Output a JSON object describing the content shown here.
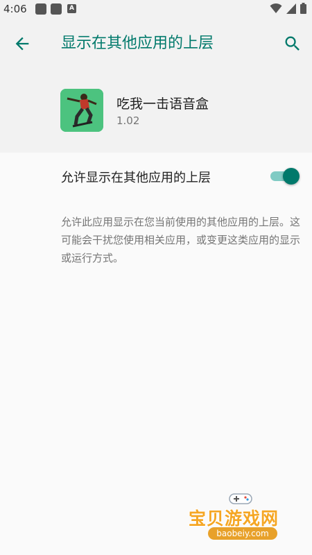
{
  "status_bar": {
    "time": "4:06",
    "notif_letter": "A"
  },
  "header": {
    "title": "显示在其他应用的上层"
  },
  "app": {
    "name": "吃我一击语音盒",
    "version": "1.02"
  },
  "setting": {
    "label": "允许显示在其他应用的上层",
    "enabled": true
  },
  "description": "允许此应用显示在您当前使用的其他应用的上层。这可能会干扰您使用相关应用，或变更这类应用的显示或运行方式。",
  "watermark": {
    "title": "宝贝游戏网",
    "url": "baobeiy.com"
  },
  "colors": {
    "accent": "#00796b",
    "switch_track": "#80cbc4",
    "app_icon_bg": "#4cc37f"
  }
}
